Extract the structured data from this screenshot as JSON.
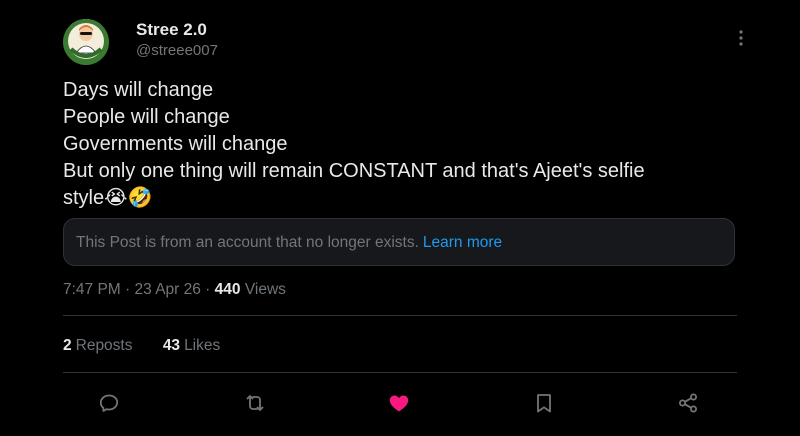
{
  "author": {
    "name": "Stree 2.0",
    "handle": "@streee007",
    "avatar_icon": "cartoon-character-avatar"
  },
  "tweet": {
    "lines": [
      "Days will change",
      "People will change",
      "Governments will change",
      "But only one thing will remain CONSTANT and that's Ajeet's selfie",
      "style😭🤣"
    ]
  },
  "notice": {
    "text": "This Post is from an account that no longer exists.",
    "link": "Learn more"
  },
  "meta": {
    "time": "7:47 PM",
    "separator1": " · ",
    "date": "23 Apr 26",
    "separator2": " · ",
    "views_count": "440",
    "views_label": "Views"
  },
  "stats": {
    "reposts_count": "2",
    "reposts_label": "Reposts",
    "likes_count": "43",
    "likes_label": "Likes"
  },
  "actions": {
    "reply_icon": "reply-icon",
    "repost_icon": "repost-icon",
    "like_icon": "heart-icon",
    "bookmark_icon": "bookmark-icon",
    "share_icon": "share-icon"
  },
  "colors": {
    "background": "#000000",
    "text_primary": "#e7e9ea",
    "text_secondary": "#71767b",
    "link": "#1d9bf0",
    "like_active": "#f91880",
    "border": "#2f3336"
  }
}
